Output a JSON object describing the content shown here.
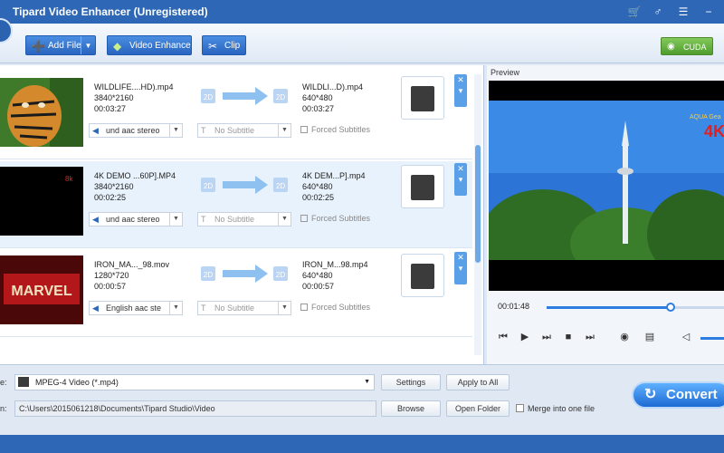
{
  "window": {
    "title": "Tipard Video Enhancer (Unregistered)",
    "icons": [
      "cart-icon",
      "register-icon",
      "menu-icon",
      "minimize-icon"
    ],
    "icon_glyphs": [
      "🛒",
      "♂",
      "☰",
      "−"
    ]
  },
  "toolbar": {
    "add_file": "Add File",
    "video_enhance": "Video Enhance",
    "clip": "Clip",
    "cuda": "CUDA"
  },
  "files": [
    {
      "src_name": "WILDLIFE....HD).mp4",
      "src_res": "3840*2160",
      "src_dur": "00:03:27",
      "dst_name": "WILDLI...D).mp4",
      "dst_res": "640*480",
      "dst_dur": "00:03:27",
      "audio": "und aac stereo",
      "subtitle": "No Subtitle",
      "forced": "Forced Subtitles"
    },
    {
      "src_name": "4K DEMO ...60P].MP4",
      "src_res": "3840*2160",
      "src_dur": "00:02:25",
      "dst_name": "4K DEM...P].mp4",
      "dst_res": "640*480",
      "dst_dur": "00:02:25",
      "audio": "und aac stereo",
      "subtitle": "No Subtitle",
      "forced": "Forced Subtitles",
      "thumb_text": "8k"
    },
    {
      "src_name": "IRON_MA..._98.mov",
      "src_res": "1280*720",
      "src_dur": "00:00:57",
      "dst_name": "IRON_M...98.mp4",
      "dst_res": "640*480",
      "dst_dur": "00:00:57",
      "audio": "English aac ste",
      "subtitle": "No Subtitle",
      "forced": "Forced Subtitles",
      "thumb_text": "MARVEL"
    }
  ],
  "labels": {
    "badge_2d": "2D",
    "row_up": "✕",
    "row_down": "▾",
    "caret": "▼"
  },
  "preview": {
    "label": "Preview",
    "time": "00:01:48",
    "progress": 0.7,
    "brand_text": "AQUA Gea",
    "res_text": "4K",
    "controls": [
      "prev-icon",
      "play-icon",
      "next-icon",
      "stop-icon",
      "end-icon",
      "snapshot-icon",
      "folder-icon",
      "volume-icon"
    ],
    "control_glyphs": [
      "⏮",
      "▶",
      "⏭",
      "■",
      "⏭",
      "◉",
      "▤",
      "◁"
    ]
  },
  "bottom": {
    "profile_label": "e:",
    "profile_value": "MPEG-4 Video (*.mp4)",
    "dest_label": "n:",
    "dest_value": "C:\\Users\\2015061218\\Documents\\Tipard Studio\\Video",
    "settings": "Settings",
    "apply_all": "Apply to All",
    "browse": "Browse",
    "open_folder": "Open Folder",
    "merge": "Merge into one file",
    "convert": "Convert"
  }
}
